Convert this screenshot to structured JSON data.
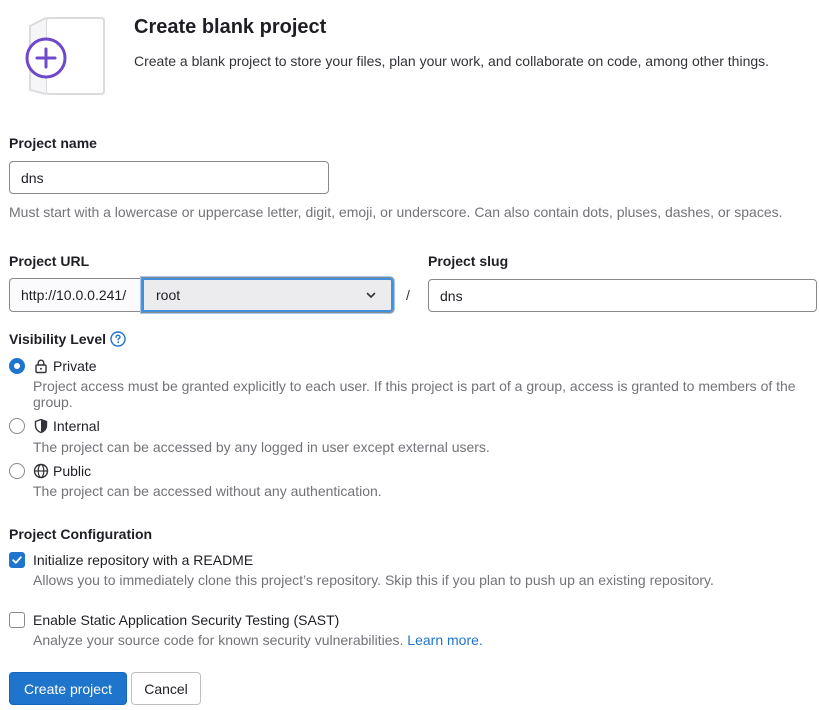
{
  "header": {
    "title": "Create blank project",
    "description": "Create a blank project to store your files, plan your work, and collaborate on code, among other things."
  },
  "project_name": {
    "label": "Project name",
    "value": "dns",
    "help": "Must start with a lowercase or uppercase letter, digit, emoji, or underscore. Can also contain dots, pluses, dashes, or spaces."
  },
  "project_url": {
    "label": "Project URL",
    "prefix": "http://10.0.0.241/",
    "namespace": "root",
    "separator": "/"
  },
  "project_slug": {
    "label": "Project slug",
    "value": "dns"
  },
  "visibility": {
    "label": "Visibility Level",
    "options": [
      {
        "label": "Private",
        "icon": "lock-icon",
        "checked": true,
        "help": "Project access must be granted explicitly to each user. If this project is part of a group, access is granted to members of the group."
      },
      {
        "label": "Internal",
        "icon": "shield-icon",
        "checked": false,
        "help": "The project can be accessed by any logged in user except external users."
      },
      {
        "label": "Public",
        "icon": "globe-icon",
        "checked": false,
        "help": "The project can be accessed without any authentication."
      }
    ]
  },
  "configuration": {
    "label": "Project Configuration",
    "readme": {
      "label": "Initialize repository with a README",
      "help": "Allows you to immediately clone this project’s repository. Skip this if you plan to push up an existing repository.",
      "checked": true
    },
    "sast": {
      "label": "Enable Static Application Security Testing (SAST)",
      "help": "Analyze your source code for known security vulnerabilities.",
      "link": "Learn more.",
      "checked": false
    }
  },
  "actions": {
    "create": "Create project",
    "cancel": "Cancel"
  },
  "colors": {
    "primary": "#1f75cb",
    "illustration_accent": "#6e49cb"
  }
}
